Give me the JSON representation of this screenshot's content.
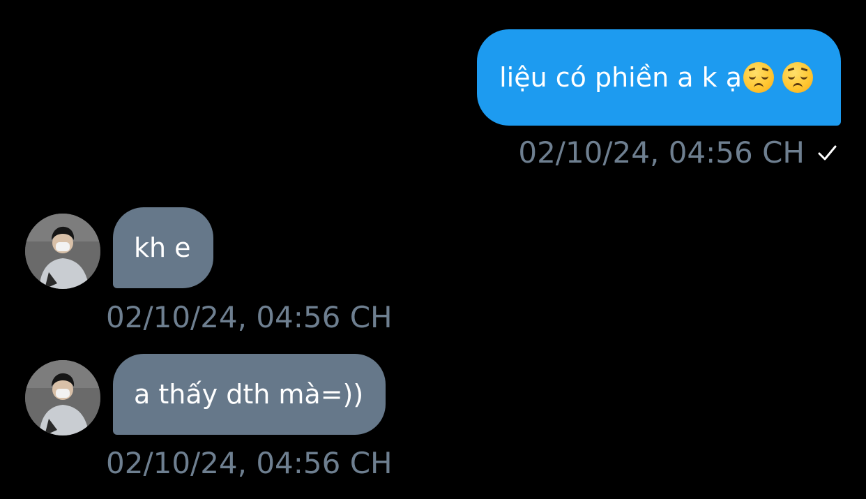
{
  "conversation": {
    "messages": [
      {
        "direction": "outgoing",
        "text": "liệu có phiền a k ạ",
        "emoji": [
          "pensive-face-emoji",
          "pensive-face-emoji"
        ],
        "timestamp": "02/10/24, 04:56 CH",
        "status_icon": "check-icon"
      },
      {
        "direction": "incoming",
        "text": "kh e",
        "timestamp": "02/10/24, 04:56 CH",
        "avatar_icon": "user-avatar"
      },
      {
        "direction": "incoming",
        "text": "a thấy dth mà=))",
        "timestamp": "02/10/24, 04:56 CH",
        "avatar_icon": "user-avatar"
      }
    ]
  },
  "colors": {
    "background": "#000000",
    "outgoing_bubble": "#1d9bf0",
    "incoming_bubble": "#66788a",
    "timestamp": "#6e7f90",
    "text": "#ffffff"
  }
}
